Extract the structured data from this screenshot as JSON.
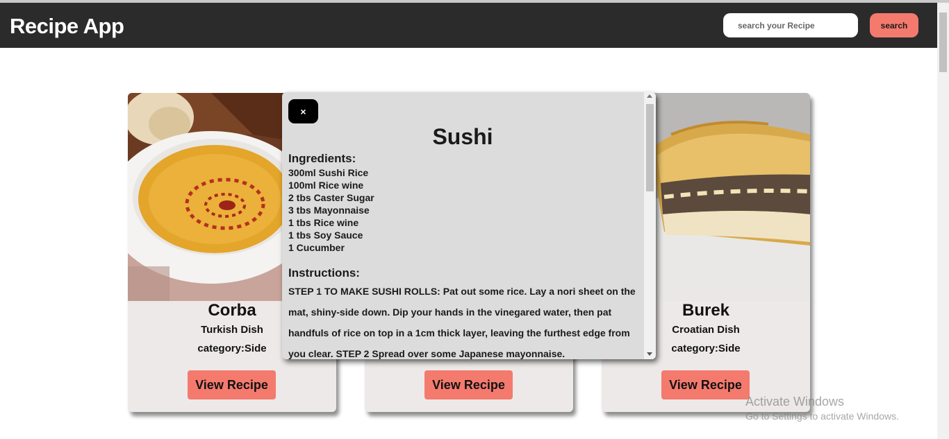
{
  "header": {
    "app_title": "Recipe App",
    "search_placeholder": "search your Recipe",
    "search_label": "search"
  },
  "cards": [
    {
      "name": "Corba",
      "area": "Turkish Dish",
      "category": "category:Side",
      "button": "View Recipe"
    },
    {
      "name": "Sushi",
      "area": "",
      "category": "",
      "button": "View Recipe"
    },
    {
      "name": "Burek",
      "area": "Croatian Dish",
      "category": "category:Side",
      "button": "View Recipe"
    }
  ],
  "modal": {
    "close_label": "×",
    "title": "Sushi",
    "ingredients_heading": "Ingredients:",
    "ingredients": [
      "300ml Sushi Rice",
      "100ml Rice wine",
      "2 tbs Caster Sugar",
      "3 tbs Mayonnaise",
      "1 tbs Rice wine",
      "1 tbs Soy Sauce",
      "1 Cucumber"
    ],
    "instructions_heading": "Instructions:",
    "instructions": "STEP 1 TO MAKE SUSHI ROLLS: Pat out some rice. Lay a nori sheet on the mat, shiny-side down. Dip your hands in the vinegared water, then pat handfuls of rice on top in a 1cm thick layer, leaving the furthest edge from you clear. STEP 2 Spread over some Japanese mayonnaise."
  },
  "watermark": {
    "line1": "Activate Windows",
    "line2": "Go to Settings to activate Windows."
  },
  "colors": {
    "header_bg": "#2b2b2b",
    "accent": "#f47a6e",
    "card_bg": "#ede9e8",
    "modal_bg": "#dcdcdc"
  }
}
